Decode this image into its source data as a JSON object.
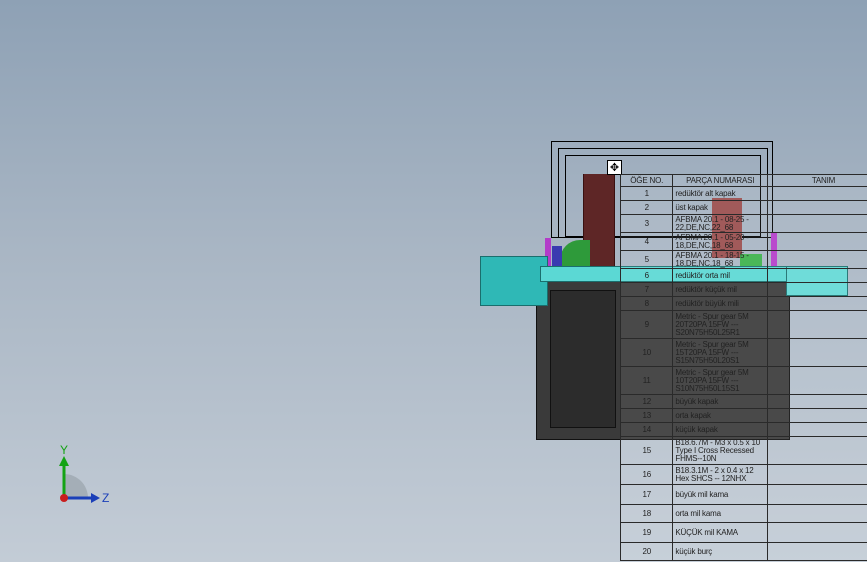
{
  "bom": {
    "headers": [
      "ÖĞE NO.",
      "PARÇA NUMARASI",
      "TANIM"
    ],
    "rows": [
      {
        "no": "1",
        "part": "redüktör alt kapak",
        "desc": ""
      },
      {
        "no": "2",
        "part": "üst kapak",
        "desc": ""
      },
      {
        "no": "3",
        "part": "AFBMA 20.1 - 08-25 - 22,DE,NC,22_68",
        "desc": ""
      },
      {
        "no": "4",
        "part": "AFBMA 20.1 - 05-20 - 18,DE,NC,18_68",
        "desc": ""
      },
      {
        "no": "5",
        "part": "AFBMA 20.1 - 18-15 - 18,DE,NC,18_68",
        "desc": ""
      },
      {
        "no": "6",
        "part": "redüktör orta mil",
        "desc": ""
      },
      {
        "no": "7",
        "part": "redüktör küçük mil",
        "desc": ""
      },
      {
        "no": "8",
        "part": "redüktör büyük mili",
        "desc": ""
      },
      {
        "no": "9",
        "part": "Metric - Spur gear 5M 20T20PA 15FW --- S20N75H50L25R1",
        "desc": ""
      },
      {
        "no": "10",
        "part": "Metric - Spur gear 5M 15T20PA 15FW --- S15N75H50L20S1",
        "desc": ""
      },
      {
        "no": "11",
        "part": "Metric - Spur gear 5M 10T20PA 15FW --- S10N75H50L15S1",
        "desc": ""
      },
      {
        "no": "12",
        "part": "büyük kapak",
        "desc": ""
      },
      {
        "no": "13",
        "part": "orta kapak",
        "desc": ""
      },
      {
        "no": "14",
        "part": "küçük kapak",
        "desc": ""
      },
      {
        "no": "15",
        "part": "B18.6.7M - M3 x 0.5 x 10 Type I Cross Recessed FHMS--10N",
        "desc": ""
      },
      {
        "no": "16",
        "part": "B18.3.1M - 2 x 0.4 x 12 Hex SHCS -- 12NHX",
        "desc": ""
      },
      {
        "no": "17",
        "part": "büyük mil kama",
        "desc": ""
      },
      {
        "no": "18",
        "part": "orta mil kama",
        "desc": ""
      },
      {
        "no": "19",
        "part": "KÜÇÜK mil KAMA",
        "desc": ""
      },
      {
        "no": "20",
        "part": "küçük burç",
        "desc": ""
      }
    ]
  },
  "triad": {
    "y_label": "Y",
    "z_label": "Z"
  },
  "colors": {
    "shaft": "#3cc9c5",
    "housing": "#333333",
    "gear": "#6b2a2a"
  }
}
